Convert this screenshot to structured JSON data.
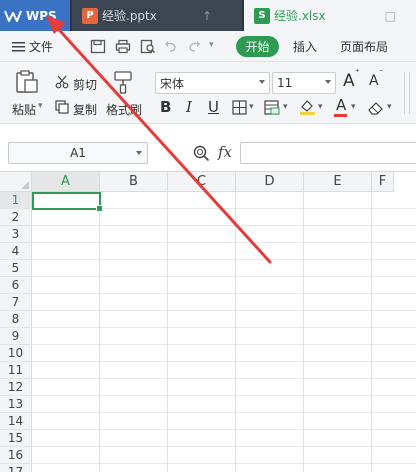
{
  "tabs": {
    "wps_label": "WPS",
    "ppt_label": "经验.pptx",
    "xls_label": "经验.xlsx",
    "ppt_icon_letter": "P",
    "xls_icon_letter": "S"
  },
  "menu": {
    "file_label": "文件",
    "start_label": "开始",
    "insert_label": "插入",
    "page_layout_label": "页面布局"
  },
  "ribbon": {
    "paste_label": "粘贴",
    "cut_label": "剪切",
    "copy_label": "复制",
    "format_painter_label": "格式刷",
    "font_name": "宋体",
    "font_size": "11",
    "bold": "B",
    "italic": "I",
    "underline": "U",
    "grow_font": "A",
    "shrink_font": "A",
    "font_color": "A"
  },
  "formula_bar": {
    "cell_reference": "A1",
    "fx_label": "fx"
  },
  "sheet": {
    "columns": [
      "A",
      "B",
      "C",
      "D",
      "E",
      "F"
    ],
    "rows": [
      "1",
      "2",
      "3",
      "4",
      "5",
      "6",
      "7",
      "8",
      "9",
      "10",
      "11",
      "12",
      "13",
      "14",
      "15",
      "16",
      "17"
    ]
  },
  "colors": {
    "accent_green": "#2f9a54",
    "annotation_red": "#e63b3b",
    "tabbar_dark": "#2b3642",
    "wps_blue": "#3a72c4"
  }
}
